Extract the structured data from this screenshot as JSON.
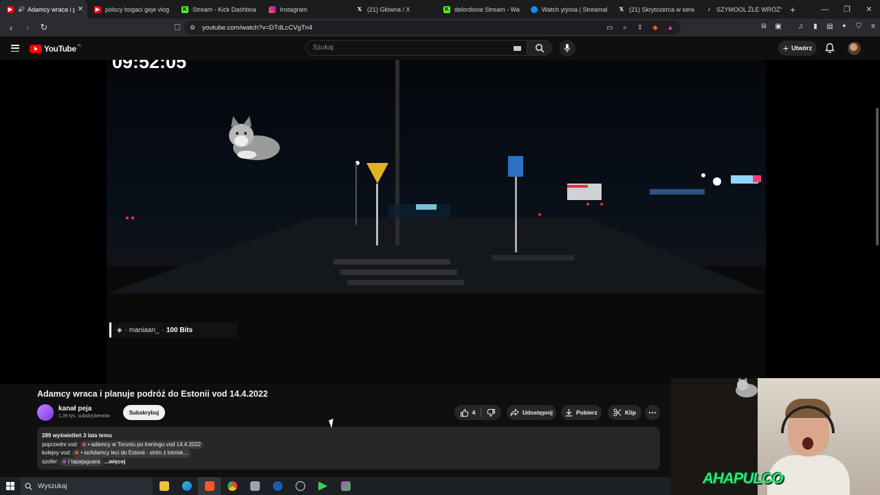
{
  "browser": {
    "tabs": [
      {
        "label": "Adamcy wraca i pl",
        "icon": "youtube-icon",
        "color": "#ff0000",
        "active": true
      },
      {
        "label": "polscy bogaci geje vlog - Y",
        "icon": "youtube-icon",
        "color": "#ff0000"
      },
      {
        "label": "Stream - Kick Dashboa",
        "icon": "kick-icon",
        "color": "#53fc18"
      },
      {
        "label": "Instagram",
        "icon": "instagram-icon",
        "color": "#e1306c"
      },
      {
        "label": "(21) Główna / X",
        "icon": "x-icon",
        "color": "#ffffff"
      },
      {
        "label": "delordione Stream - Watc",
        "icon": "kick-icon",
        "color": "#53fc18"
      },
      {
        "label": "Watch yrjnoa | Streamable",
        "icon": "streamable-icon",
        "color": "#0f90fa"
      },
      {
        "label": "(21) Skrytożerca w serwis",
        "icon": "x-icon",
        "color": "#ffffff"
      },
      {
        "label": "SZYMOOL ŹLE WRÓŻY KA",
        "icon": "tiktok-icon",
        "color": "#ffffff"
      }
    ],
    "new_tab": "+",
    "url": "youtube.com/watch?v=DTdLcCVgTn4"
  },
  "youtube": {
    "logo_text": "YouTube",
    "country": "PL",
    "search_placeholder": "Szukaj",
    "create_label": "Utwórz",
    "brand_color": "#ff0000"
  },
  "video": {
    "timer_overlay": "09:52:05",
    "alert_user": "· maniaan_ ·",
    "alert_amount": "100 Bits",
    "title": "Adamcy wraca i planuje podróż do Estonii vod 14.4.2022",
    "channel_name": "kanał peja",
    "channel_subs": "1,39 tys. subskrybentów",
    "subscribe_label": "Subskrybuj",
    "likes": "4",
    "share_label": "Udostępnij",
    "download_label": "Pobierz",
    "clip_label": "Klip",
    "description": {
      "stats": "289 wyświetleń  3 lata temu",
      "line1_prefix": "poprzedni vod:",
      "line1_link": "• adamcy w Toruniu po treningu vod 14.4.2022",
      "line2_prefix": "kolejny vod:",
      "line2_link": "• ᴇᴇAdamcy leci do Estonii - strim z lotnisk...",
      "line3_prefix": "szofer:",
      "line3_link": "/ lapajaguara",
      "more": "...więcej"
    }
  },
  "webcam": {
    "logo": "AHAPULCO"
  },
  "taskbar": {
    "search_label": "Wyszukaj",
    "apps": [
      "file-explorer-icon",
      "edge-icon",
      "brave-icon",
      "chrome-icon",
      "files-icon",
      "steam-icon",
      "obs-icon",
      "media-icon",
      "game-icon"
    ]
  }
}
